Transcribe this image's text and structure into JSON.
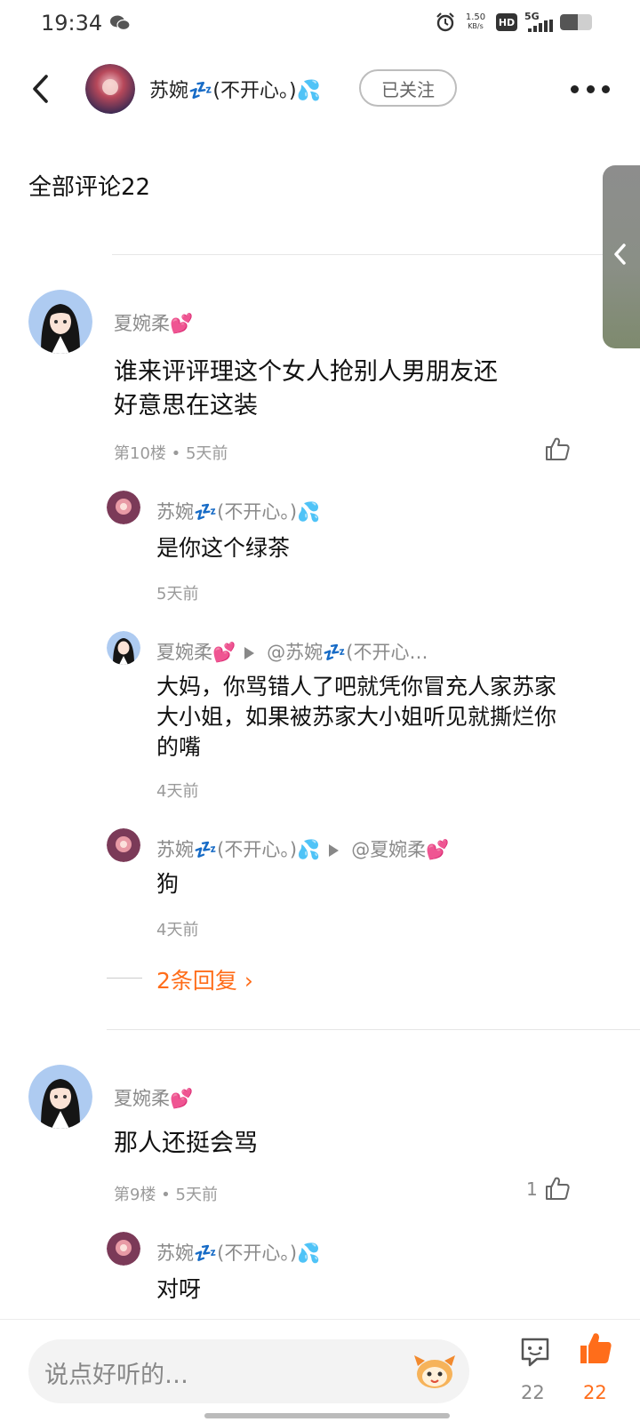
{
  "status_bar": {
    "time": "19:34",
    "net_speed_value": "1.50",
    "net_speed_unit": "KB/s",
    "hd": "HD",
    "network": "5G",
    "battery_level": 0.55
  },
  "header": {
    "username": "苏婉💤(不开心。)💦",
    "follow_label": "已关注"
  },
  "section": {
    "title": "全部评论22"
  },
  "comments": [
    {
      "user": "夏婉柔💕",
      "text_line1": "谁来评评理这个女人抢别人男朋友还",
      "text_line2": "好意思在这装",
      "meta": "第10楼 • 5天前",
      "likes": "",
      "replies": [
        {
          "user": "苏婉💤(不开心。)💦",
          "reply_to": "",
          "text": "是你这个绿茶",
          "time": "5天前"
        },
        {
          "user": "夏婉柔💕",
          "reply_to": "@苏婉💤(不开心…",
          "text_line1": "大妈，你骂错人了吧就凭你冒充人家苏家",
          "text_line2": "大小姐，如果被苏家大小姐听见就撕烂你",
          "text_line3": "的嘴",
          "time": "4天前"
        },
        {
          "user": "苏婉💤(不开心。)💦",
          "reply_to": "@夏婉柔💕",
          "text": "狗",
          "time": "4天前"
        }
      ],
      "more_replies": "2条回复 ›"
    },
    {
      "user": "夏婉柔💕",
      "text": "那人还挺会骂",
      "meta": "第9楼 • 5天前",
      "likes": "1",
      "replies": [
        {
          "user": "苏婉💤(不开心。)💦",
          "text": "对呀"
        }
      ]
    }
  ],
  "bottom_bar": {
    "placeholder": "说点好听的…",
    "comment_count": "22",
    "like_count": "22"
  },
  "colors": {
    "accent": "#ff6d1a",
    "muted": "#8a8a8a"
  },
  "icons": [
    "back-icon",
    "more-icon",
    "chevron-left-icon",
    "thumbs-up-icon",
    "comment-icon",
    "mascot-icon",
    "alarm-icon",
    "wechat-icon"
  ]
}
